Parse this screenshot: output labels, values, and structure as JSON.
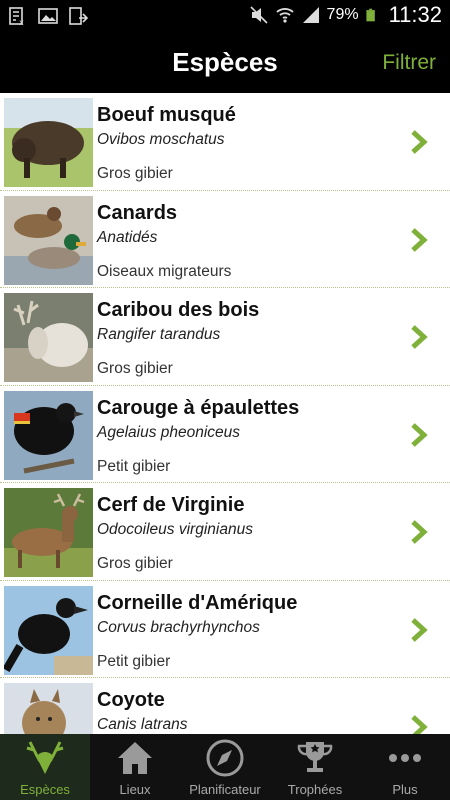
{
  "status_bar": {
    "battery_pct": "79%",
    "time": "11:32"
  },
  "header": {
    "title": "Espèces",
    "filter_label": "Filtrer"
  },
  "species": [
    {
      "name": "Boeuf musqué",
      "latin": "Ovibos moschatus",
      "category": "Gros gibier"
    },
    {
      "name": "Canards",
      "latin": "Anatidés",
      "category": "Oiseaux migrateurs"
    },
    {
      "name": "Caribou des bois",
      "latin": "Rangifer tarandus",
      "category": "Gros gibier"
    },
    {
      "name": "Carouge à épaulettes",
      "latin": "Agelaius pheoniceus",
      "category": "Petit gibier"
    },
    {
      "name": "Cerf de Virginie",
      "latin": "Odocoileus virginianus",
      "category": "Gros gibier"
    },
    {
      "name": "Corneille d'Amérique",
      "latin": "Corvus brachyrhynchos",
      "category": "Petit gibier"
    },
    {
      "name": "Coyote",
      "latin": "Canis latrans",
      "category": ""
    }
  ],
  "nav": [
    {
      "label": "Espèces",
      "icon": "deer-head-icon",
      "active": true
    },
    {
      "label": "Lieux",
      "icon": "home-icon",
      "active": false
    },
    {
      "label": "Planificateur",
      "icon": "compass-icon",
      "active": false
    },
    {
      "label": "Trophées",
      "icon": "trophy-icon",
      "active": false
    },
    {
      "label": "Plus",
      "icon": "more-dots-icon",
      "active": false
    }
  ],
  "colors": {
    "accent": "#7fb03a",
    "header_bg": "#000000",
    "nav_bg": "#111111"
  }
}
